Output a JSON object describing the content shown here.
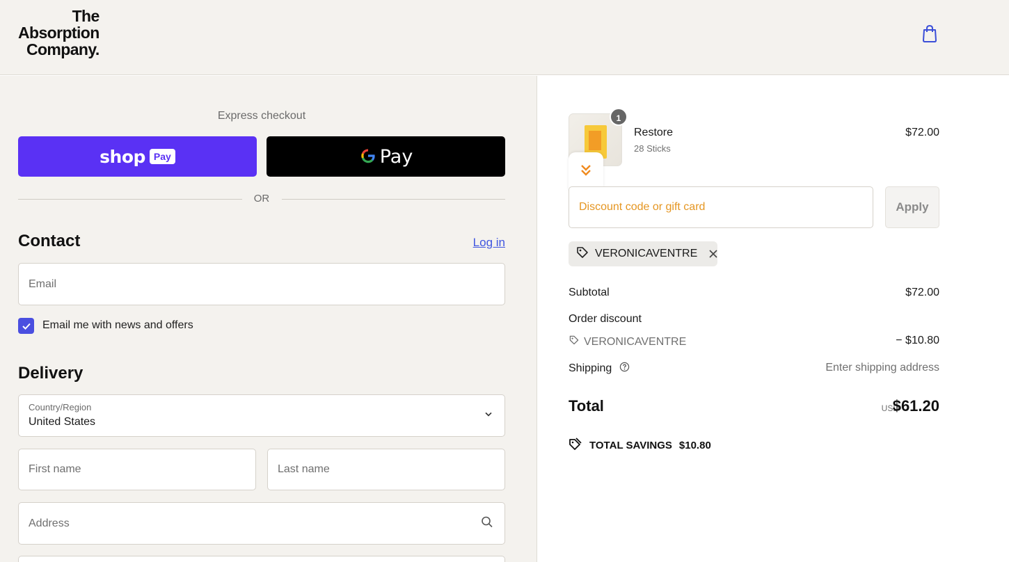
{
  "brand": {
    "lines": [
      "The",
      "Absorption",
      "Company."
    ]
  },
  "header": {
    "cart_icon": "shopping-bag-icon",
    "accent": "#3b4fd8"
  },
  "express": {
    "title": "Express checkout",
    "shop_word": "shop",
    "shop_pay": "Pay",
    "gpay_word": "Pay",
    "or": "OR"
  },
  "contact": {
    "title": "Contact",
    "login": "Log in",
    "email_placeholder": "Email",
    "newsletter": "Email me with news and offers"
  },
  "delivery": {
    "title": "Delivery",
    "country_label": "Country/Region",
    "country_value": "United States",
    "first_name_placeholder": "First name",
    "last_name_placeholder": "Last name",
    "address_placeholder": "Address"
  },
  "order": {
    "item": {
      "name": "Restore",
      "variant": "28 Sticks",
      "price": "$72.00",
      "quantity": "1"
    },
    "discount_placeholder": "Discount code or gift card",
    "apply": "Apply",
    "applied_code": "VERONICAVENTRE",
    "subtotal_label": "Subtotal",
    "subtotal_value": "$72.00",
    "discount_label": "Order discount",
    "discount_code": "VERONICAVENTRE",
    "discount_value": "− $10.80",
    "shipping_label": "Shipping",
    "shipping_value": "Enter shipping address",
    "total_label": "Total",
    "total_currency": "USD",
    "total_value": "$61.20",
    "savings_label": "TOTAL SAVINGS",
    "savings_value": "$10.80"
  },
  "colors": {
    "shop_pay": "#5a31f4",
    "gpay": "#000000",
    "checkbox": "#4a4fe0",
    "link": "#4056e0",
    "discount_placeholder": "#e59622"
  }
}
